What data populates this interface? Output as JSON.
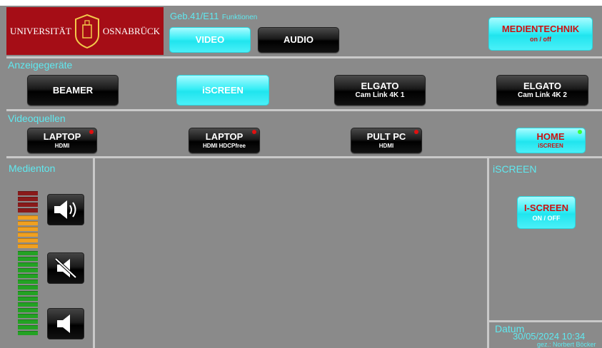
{
  "logo": {
    "left_text": "UNIVERSITÄT",
    "right_text": "OSNABRÜCK",
    "bg_color": "#a50d16"
  },
  "header": {
    "title": "Geb.41/E11",
    "subtitle": "Funktionen",
    "video_label": "VIDEO",
    "audio_label": "AUDIO",
    "medientechnik_label": "MEDIENTECHNIK",
    "medientechnik_sub": "on / off"
  },
  "anzeige": {
    "section_label": "Anzeigegeräte",
    "buttons": [
      {
        "main": "BEAMER",
        "sub": ""
      },
      {
        "main": "iSCREEN",
        "sub": ""
      },
      {
        "main": "ELGATO",
        "sub": "Cam Link 4K 1"
      },
      {
        "main": "ELGATO",
        "sub": "Cam Link 4K 2"
      }
    ]
  },
  "videoquellen": {
    "section_label": "Videoquellen",
    "buttons": [
      {
        "main": "LAPTOP",
        "sub": "HDMI",
        "status": "red"
      },
      {
        "main": "LAPTOP",
        "sub": "HDMI HDCPfree",
        "status": "red"
      },
      {
        "main": "PULT PC",
        "sub": "HDMI",
        "status": "red"
      },
      {
        "main": "HOME",
        "sub": "iSCREEN",
        "status": "green"
      }
    ]
  },
  "medienton": {
    "section_label": "Medienton",
    "icons": [
      "volume-up-icon",
      "mute-icon",
      "volume-down-icon"
    ]
  },
  "iscreen": {
    "section_label": "iSCREEN",
    "button_main": "I-SCREEN",
    "button_sub": "ON / OFF"
  },
  "datum": {
    "label": "Datum",
    "datetime": "30/05/2024 10:34",
    "author": "gez.: Norbert Böcker"
  },
  "colors": {
    "accent_cyan": "#5fe9f0",
    "panel_gray": "#8b8b8b",
    "status_red": "#e01010",
    "status_green": "#3cff3c"
  }
}
